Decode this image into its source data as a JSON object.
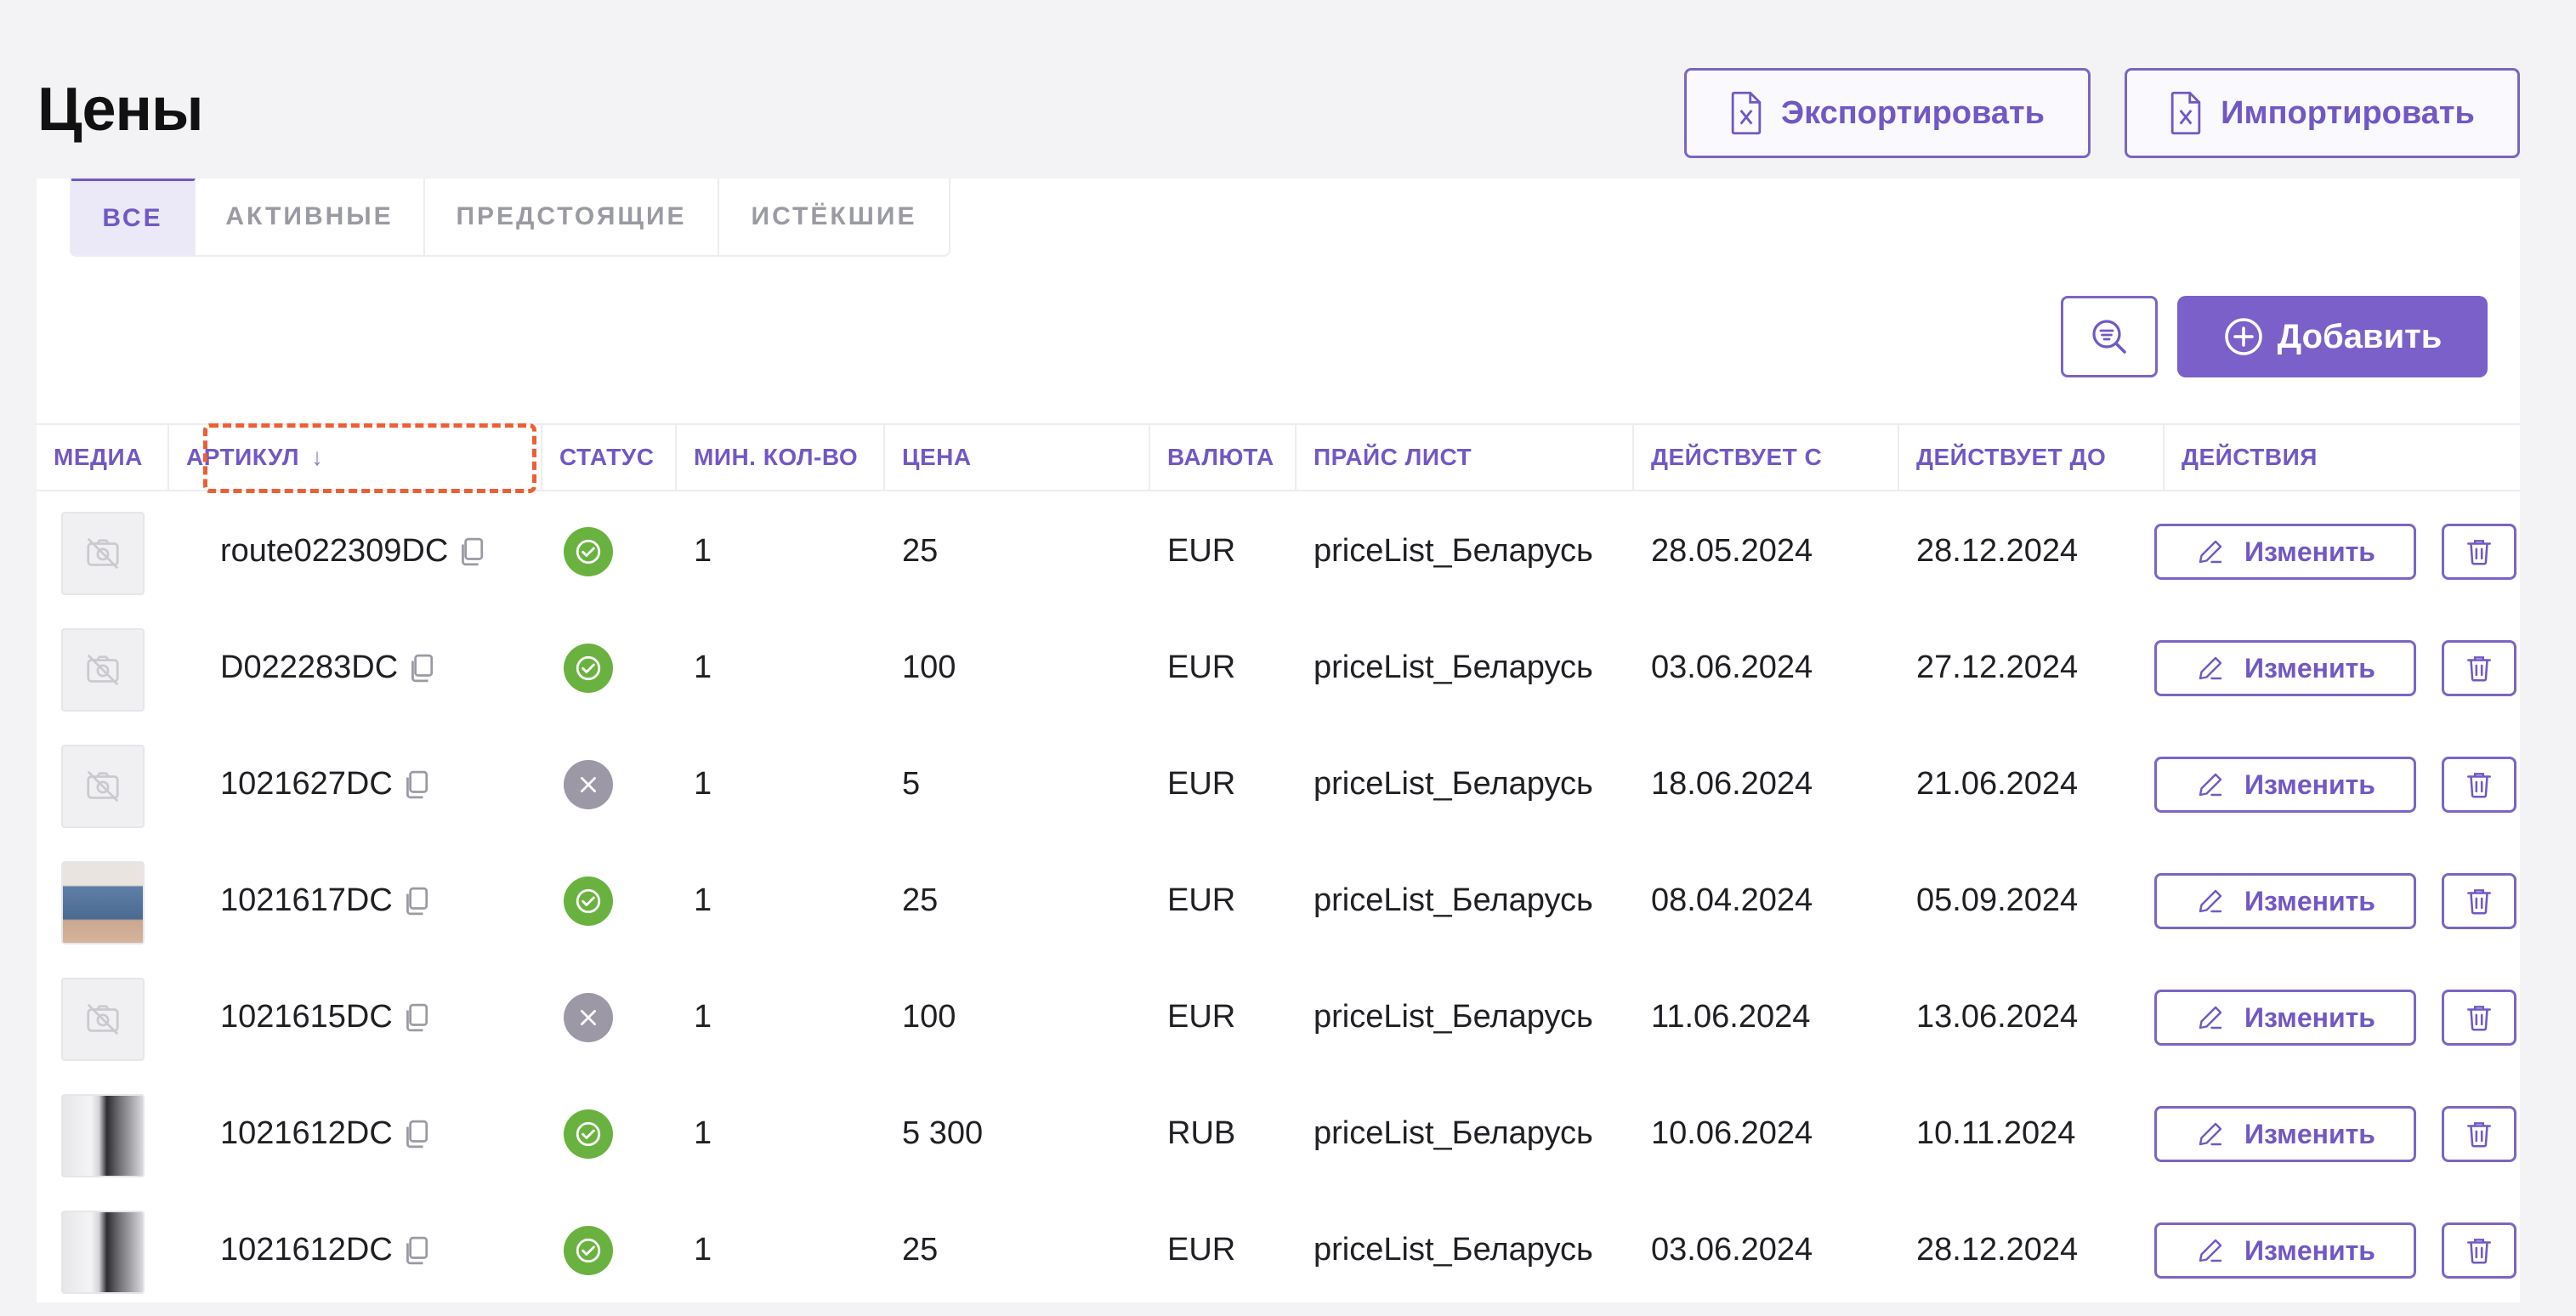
{
  "page_title": "Цены",
  "header": {
    "export_label": "Экспортировать",
    "import_label": "Импортировать"
  },
  "tabs": [
    {
      "label": "ВСЕ",
      "active": true
    },
    {
      "label": "АКТИВНЫЕ",
      "active": false
    },
    {
      "label": "ПРЕДСТОЯЩИЕ",
      "active": false
    },
    {
      "label": "ИСТЁКШИЕ",
      "active": false
    }
  ],
  "toolbar": {
    "add_label": "Добавить",
    "filter_icon": "search-filter-icon"
  },
  "table": {
    "columns": [
      "МЕДИА",
      "АРТИКУЛ",
      "СТАТУС",
      "МИН. КОЛ-ВО",
      "ЦЕНА",
      "ВАЛЮТА",
      "ПРАЙС ЛИСТ",
      "ДЕЙСТВУЕТ С",
      "ДЕЙСТВУЕТ ДО",
      "ДЕЙСТВИЯ"
    ],
    "sort_arrow": "↓",
    "edit_label": "Изменить",
    "rows": [
      {
        "media": "no-image",
        "sku": "route022309DC",
        "status": "active",
        "min_qty": "1",
        "price": "25",
        "currency": "EUR",
        "price_list": "priceList_Беларусь",
        "valid_from": "28.05.2024",
        "valid_to": "28.12.2024"
      },
      {
        "media": "no-image",
        "sku": "D022283DC",
        "status": "active",
        "min_qty": "1",
        "price": "100",
        "currency": "EUR",
        "price_list": "priceList_Беларусь",
        "valid_from": "03.06.2024",
        "valid_to": "27.12.2024"
      },
      {
        "media": "no-image",
        "sku": "1021627DC",
        "status": "inactive",
        "min_qty": "1",
        "price": "5",
        "currency": "EUR",
        "price_list": "priceList_Беларусь",
        "valid_from": "18.06.2024",
        "valid_to": "21.06.2024"
      },
      {
        "media": "jeans",
        "sku": "1021617DC",
        "status": "active",
        "min_qty": "1",
        "price": "25",
        "currency": "EUR",
        "price_list": "priceList_Беларусь",
        "valid_from": "08.04.2024",
        "valid_to": "05.09.2024"
      },
      {
        "media": "no-image",
        "sku": "1021615DC",
        "status": "inactive",
        "min_qty": "1",
        "price": "100",
        "currency": "EUR",
        "price_list": "priceList_Беларусь",
        "valid_from": "11.06.2024",
        "valid_to": "13.06.2024"
      },
      {
        "media": "phone",
        "sku": "1021612DC",
        "status": "active",
        "min_qty": "1",
        "price": "5 300",
        "currency": "RUB",
        "price_list": "priceList_Беларусь",
        "valid_from": "10.06.2024",
        "valid_to": "10.11.2024"
      },
      {
        "media": "phone",
        "sku": "1021612DC",
        "status": "active",
        "min_qty": "1",
        "price": "25",
        "currency": "EUR",
        "price_list": "priceList_Беларусь",
        "valid_from": "03.06.2024",
        "valid_to": "28.12.2024"
      }
    ]
  },
  "colors": {
    "accent": "#7b60c9",
    "status_active": "#6ab23f",
    "status_inactive": "#9c98a6",
    "sort_highlight": "#ec5f35"
  }
}
